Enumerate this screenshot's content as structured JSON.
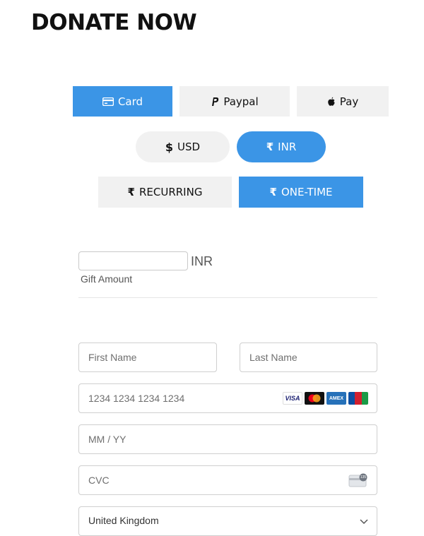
{
  "page": {
    "title": "DONATE NOW"
  },
  "payment_methods": [
    {
      "label": "Card",
      "icon": "credit-card-icon",
      "active": true
    },
    {
      "label": "Paypal",
      "icon": "paypal-icon",
      "active": false
    },
    {
      "label": "Pay",
      "icon": "apple-icon",
      "active": false
    }
  ],
  "currencies": [
    {
      "label": "USD",
      "icon": "dollar-icon",
      "active": false
    },
    {
      "label": "INR",
      "icon": "rupee-icon",
      "active": true
    }
  ],
  "frequency": [
    {
      "label": "RECURRING",
      "icon": "rupee-icon",
      "active": false
    },
    {
      "label": "ONE-TIME",
      "icon": "rupee-icon",
      "active": true
    }
  ],
  "amount": {
    "value": "",
    "currency": "INR",
    "label": "Gift Amount"
  },
  "form": {
    "first_name_placeholder": "First Name",
    "last_name_placeholder": "Last Name",
    "card_number_placeholder": "1234 1234 1234 1234",
    "expiry_placeholder": "MM / YY",
    "cvc_placeholder": "CVC",
    "country_value": "United Kingdom",
    "card_brands": [
      "VISA",
      "mastercard",
      "AMEX",
      "JCB"
    ],
    "cvc_badge": "135"
  },
  "colors": {
    "accent": "#3b95e6",
    "inactive": "#f1f1f1"
  }
}
